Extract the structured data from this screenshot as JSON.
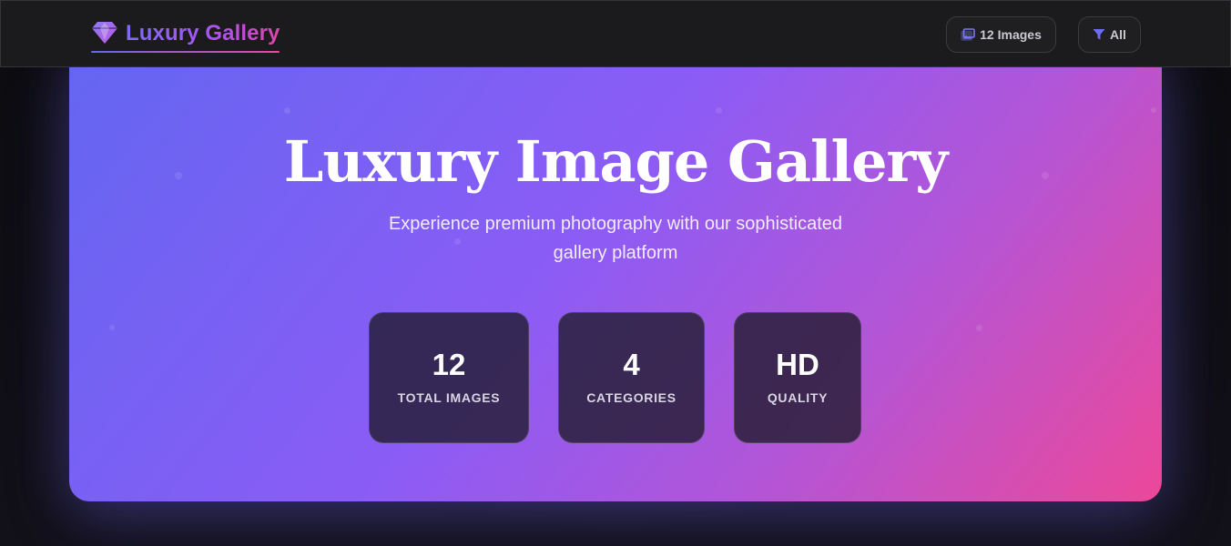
{
  "header": {
    "brand": {
      "icon": "gem-icon",
      "title": "Luxury Gallery"
    },
    "images_button": {
      "icon": "images-icon",
      "label": "12 Images"
    },
    "filter_button": {
      "icon": "filter-icon",
      "label": "All"
    }
  },
  "hero": {
    "title": "Luxury Image Gallery",
    "subtitle": "Experience premium photography with our sophisticated gallery platform",
    "stats": [
      {
        "value": "12",
        "label": "TOTAL IMAGES"
      },
      {
        "value": "4",
        "label": "CATEGORIES"
      },
      {
        "value": "HD",
        "label": "QUALITY"
      }
    ]
  },
  "colors": {
    "accent_start": "#6366f1",
    "accent_mid": "#8b5cf6",
    "accent_end": "#ec4899",
    "header_bg": "#1b1b1d",
    "page_bg": "#0d0d10"
  }
}
